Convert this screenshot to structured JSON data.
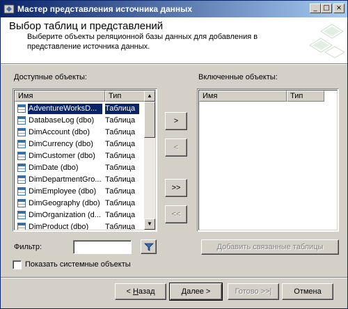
{
  "window": {
    "title": "Мастер представления источника данных",
    "controls": {
      "minimize": "_",
      "maximize": "□",
      "close": "×"
    }
  },
  "header": {
    "title": "Выбор таблиц и представлений",
    "description": "Выберите объекты реляционной базы данных для добавления в представление источника данных."
  },
  "available": {
    "label": "Доступные объекты:",
    "columns": {
      "name": "Имя",
      "type": "Тип"
    },
    "rows": [
      {
        "name": "AdventureWorksD...",
        "type": "Таблица"
      },
      {
        "name": "DatabaseLog (dbo)",
        "type": "Таблица"
      },
      {
        "name": "DimAccount (dbo)",
        "type": "Таблица"
      },
      {
        "name": "DimCurrency (dbo)",
        "type": "Таблица"
      },
      {
        "name": "DimCustomer (dbo)",
        "type": "Таблица"
      },
      {
        "name": "DimDate (dbo)",
        "type": "Таблица"
      },
      {
        "name": "DimDepartmentGro...",
        "type": "Таблица"
      },
      {
        "name": "DimEmployee (dbo)",
        "type": "Таблица"
      },
      {
        "name": "DimGeography (dbo)",
        "type": "Таблица"
      },
      {
        "name": "DimOrganization (d...",
        "type": "Таблица"
      },
      {
        "name": "DimProduct (dbo)",
        "type": "Таблица"
      }
    ],
    "selected_index": 0
  },
  "included": {
    "label": "Включенные объекты:",
    "columns": {
      "name": "Имя",
      "type": "Тип"
    }
  },
  "move_buttons": {
    "add": ">",
    "remove": "<",
    "add_all": ">>",
    "remove_all": "<<"
  },
  "filter": {
    "label": "Фильтр:",
    "value": "",
    "icon": "filter-icon"
  },
  "add_related_button": "Добавить связанные таблицы",
  "show_system_objects": {
    "label": "Показать системные объекты",
    "checked": false
  },
  "footer": {
    "back": {
      "prefix": "< ",
      "accel": "Н",
      "rest": "азад"
    },
    "next": {
      "accel": "Д",
      "rest": "алее >"
    },
    "finish": "Готово >>|",
    "cancel": "Отмена"
  },
  "colors": {
    "title_start": "#0a246a",
    "title_end": "#a6caf0",
    "selection": "#0a246a",
    "face": "#d4d0c8"
  }
}
